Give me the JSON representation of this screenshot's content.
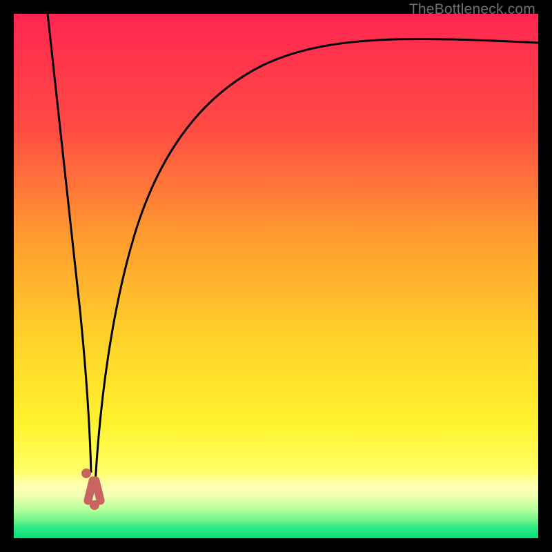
{
  "watermark": "TheBottleneck.com",
  "chart_data": {
    "type": "line",
    "title": "",
    "xlabel": "",
    "ylabel": "",
    "xlim": [
      0,
      100
    ],
    "ylim": [
      0,
      100
    ],
    "grid": false,
    "gradient_background": {
      "top": "#ff2651",
      "upper_mid": "#ff7e34",
      "mid": "#ffe52b",
      "lower_mid": "#f8ff77",
      "band": "#ffffb3",
      "base": "#05e67b"
    },
    "series": [
      {
        "name": "left-branch",
        "type": "curve",
        "x": [
          6.5,
          8.0,
          10.0,
          12.0,
          13.5,
          14.8
        ],
        "y": [
          100,
          82,
          58,
          32,
          12,
          0
        ]
      },
      {
        "name": "right-branch",
        "type": "curve",
        "x": [
          15.5,
          17.5,
          20.0,
          25.0,
          32.0,
          42.0,
          55.0,
          70.0,
          85.0,
          100.0
        ],
        "y": [
          0,
          22,
          42,
          62,
          76,
          84,
          89,
          92,
          93.5,
          94.5
        ]
      }
    ],
    "markers": [
      {
        "name": "dip-marker-left",
        "x": 13.8,
        "y": 12.5,
        "shape": "dot"
      },
      {
        "name": "dip-marker-v",
        "x": 15.0,
        "y": 5.0,
        "shape": "v"
      }
    ]
  }
}
